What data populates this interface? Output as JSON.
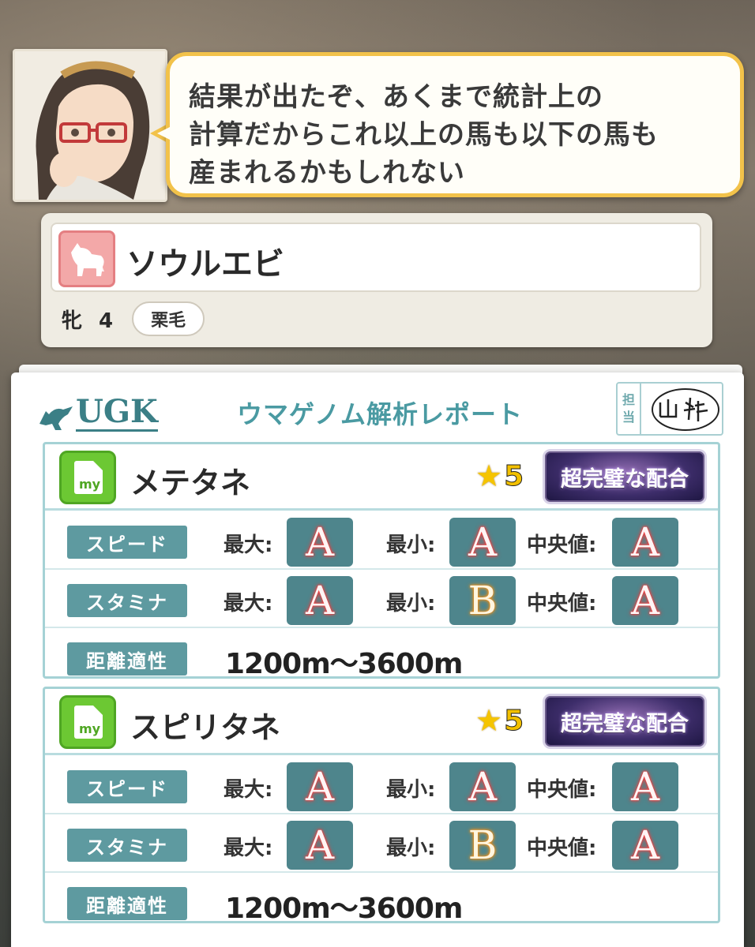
{
  "dialogue": {
    "lines": [
      "結果が出たぞ、あくまで統計上の",
      "計算だからこれ以上の馬も以下の馬も",
      "産まれるかもしれない"
    ]
  },
  "horse": {
    "name": "ソウルエビ",
    "sex_age": "牝 4",
    "coat": "栗毛"
  },
  "report": {
    "logo": "UGK",
    "title": "ウマゲノム解析レポート",
    "stamp_label_1": "担",
    "stamp_label_2": "当"
  },
  "labels": {
    "speed": "スピード",
    "stamina": "スタミナ",
    "distance": "距離適性",
    "max": "最大:",
    "min": "最小:",
    "median": "中央値:",
    "my": "my"
  },
  "seeds": [
    {
      "name": "メテタネ",
      "star": "★",
      "rating": "5",
      "badge": "超完璧な配合",
      "speed": {
        "max": "A",
        "min": "A",
        "median": "A"
      },
      "stamina": {
        "max": "A",
        "min": "B",
        "median": "A"
      },
      "distance": "1200m〜3600m"
    },
    {
      "name": "スピリタネ",
      "star": "★",
      "rating": "5",
      "badge": "超完璧な配合",
      "speed": {
        "max": "A",
        "min": "A",
        "median": "A"
      },
      "stamina": {
        "max": "A",
        "min": "B",
        "median": "A"
      },
      "distance": "1200m〜3600m"
    }
  ],
  "colors": {
    "bubble_border": "#f2c24a",
    "teal_label": "#5e9aa0",
    "grade_bg": "#4e858c",
    "my_icon": "#6cc833",
    "horse_icon": "#f3a8a8"
  }
}
